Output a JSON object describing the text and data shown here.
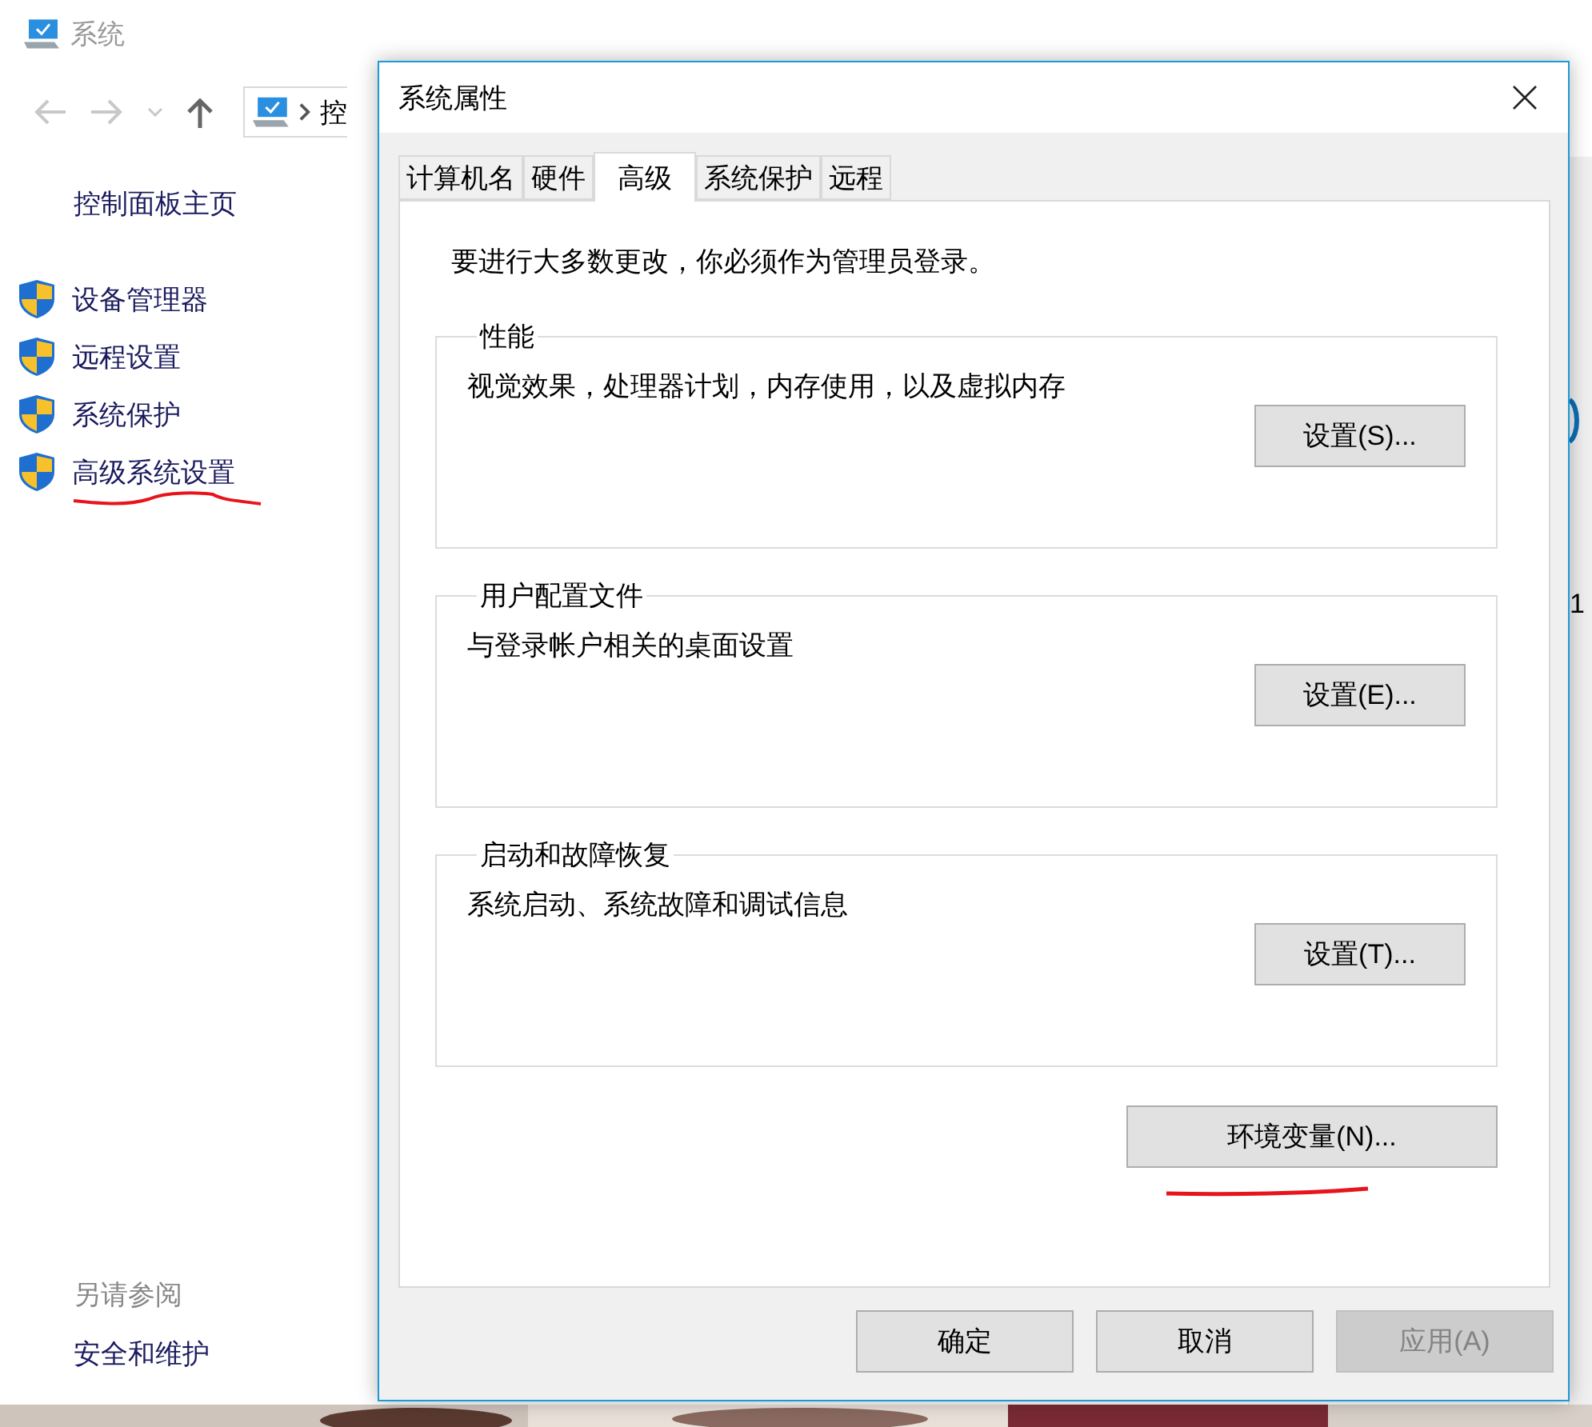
{
  "window": {
    "title": "系统",
    "address_fragment": "控",
    "edge_text": "1"
  },
  "sidebar": {
    "home_link": "控制面板主页",
    "items": [
      {
        "label": "设备管理器",
        "underlined": false
      },
      {
        "label": "远程设置",
        "underlined": false
      },
      {
        "label": "系统保护",
        "underlined": false
      },
      {
        "label": "高级系统设置",
        "underlined": true
      }
    ],
    "see_also": {
      "heading": "另请参阅",
      "links": [
        "安全和维护"
      ]
    }
  },
  "dialog": {
    "title": "系统属性",
    "tabs": [
      {
        "label": "计算机名",
        "selected": false
      },
      {
        "label": "硬件",
        "selected": false
      },
      {
        "label": "高级",
        "selected": true
      },
      {
        "label": "系统保护",
        "selected": false
      },
      {
        "label": "远程",
        "selected": false
      }
    ],
    "notice": "要进行大多数更改，你必须作为管理员登录。",
    "groups": [
      {
        "title": "性能",
        "description": "视觉效果，处理器计划，内存使用，以及虚拟内存",
        "button": "设置(S)..."
      },
      {
        "title": "用户配置文件",
        "description": "与登录帐户相关的桌面设置",
        "button": "设置(E)..."
      },
      {
        "title": "启动和故障恢复",
        "description": "系统启动、系统故障和调试信息",
        "button": "设置(T)..."
      }
    ],
    "env_button": {
      "label": "环境变量(N)...",
      "underlined": true
    },
    "buttons": [
      {
        "label": "确定",
        "disabled": false
      },
      {
        "label": "取消",
        "disabled": false
      },
      {
        "label": "应用(A)",
        "disabled": true
      }
    ]
  }
}
